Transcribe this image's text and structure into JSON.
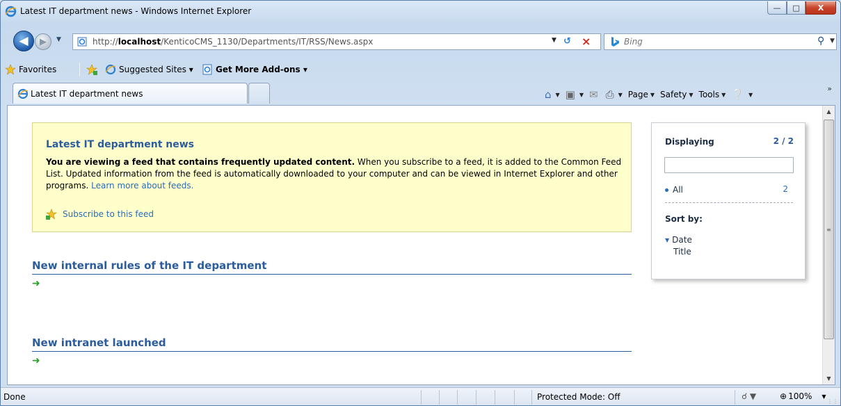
{
  "window": {
    "title": "Latest IT department news - Windows Internet Explorer",
    "controls": {
      "minimize": "—",
      "maximize": "□",
      "close": "X"
    }
  },
  "address_bar": {
    "url_prefix": "http://",
    "url_host": "localhost",
    "url_path": "/KenticoCMS_1130/Departments/IT/RSS/News.aspx"
  },
  "search": {
    "placeholder": "Bing"
  },
  "favorites_bar": {
    "favorites_label": "Favorites",
    "suggested_sites_label": "Suggested Sites ▾",
    "get_addons_label": "Get More Add-ons ▾"
  },
  "tabs": [
    {
      "label": "Latest IT department news"
    }
  ],
  "command_bar": {
    "page_label": "Page",
    "safety_label": "Safety",
    "tools_label": "Tools"
  },
  "feed": {
    "title": "Latest IT department news",
    "desc_bold": "You are viewing a feed that contains frequently updated content.",
    "desc_text": " When you subscribe to a feed, it is added to the Common Feed List. Updated information from the feed is automatically downloaded to your computer and can be viewed in Internet Explorer and other programs. ",
    "learn_more": "Learn more about feeds.",
    "subscribe_label": "Subscribe to this feed",
    "entries": [
      {
        "title": "New internal rules of the IT department"
      },
      {
        "title": "New intranet launched"
      }
    ]
  },
  "side_panel": {
    "displaying_label": "Displaying",
    "count": "2 / 2",
    "all_label": "All",
    "all_count": "2",
    "sort_by_label": "Sort by:",
    "sort_date_label": "Date",
    "sort_title_label": "Title"
  },
  "status_bar": {
    "status_text": "Done",
    "protected_mode": "Protected Mode: Off",
    "zoom": "100%"
  },
  "colors": {
    "link_blue": "#2b5c9e",
    "feed_header_bg": "#ffffcc",
    "close_red": "#c9452c"
  }
}
